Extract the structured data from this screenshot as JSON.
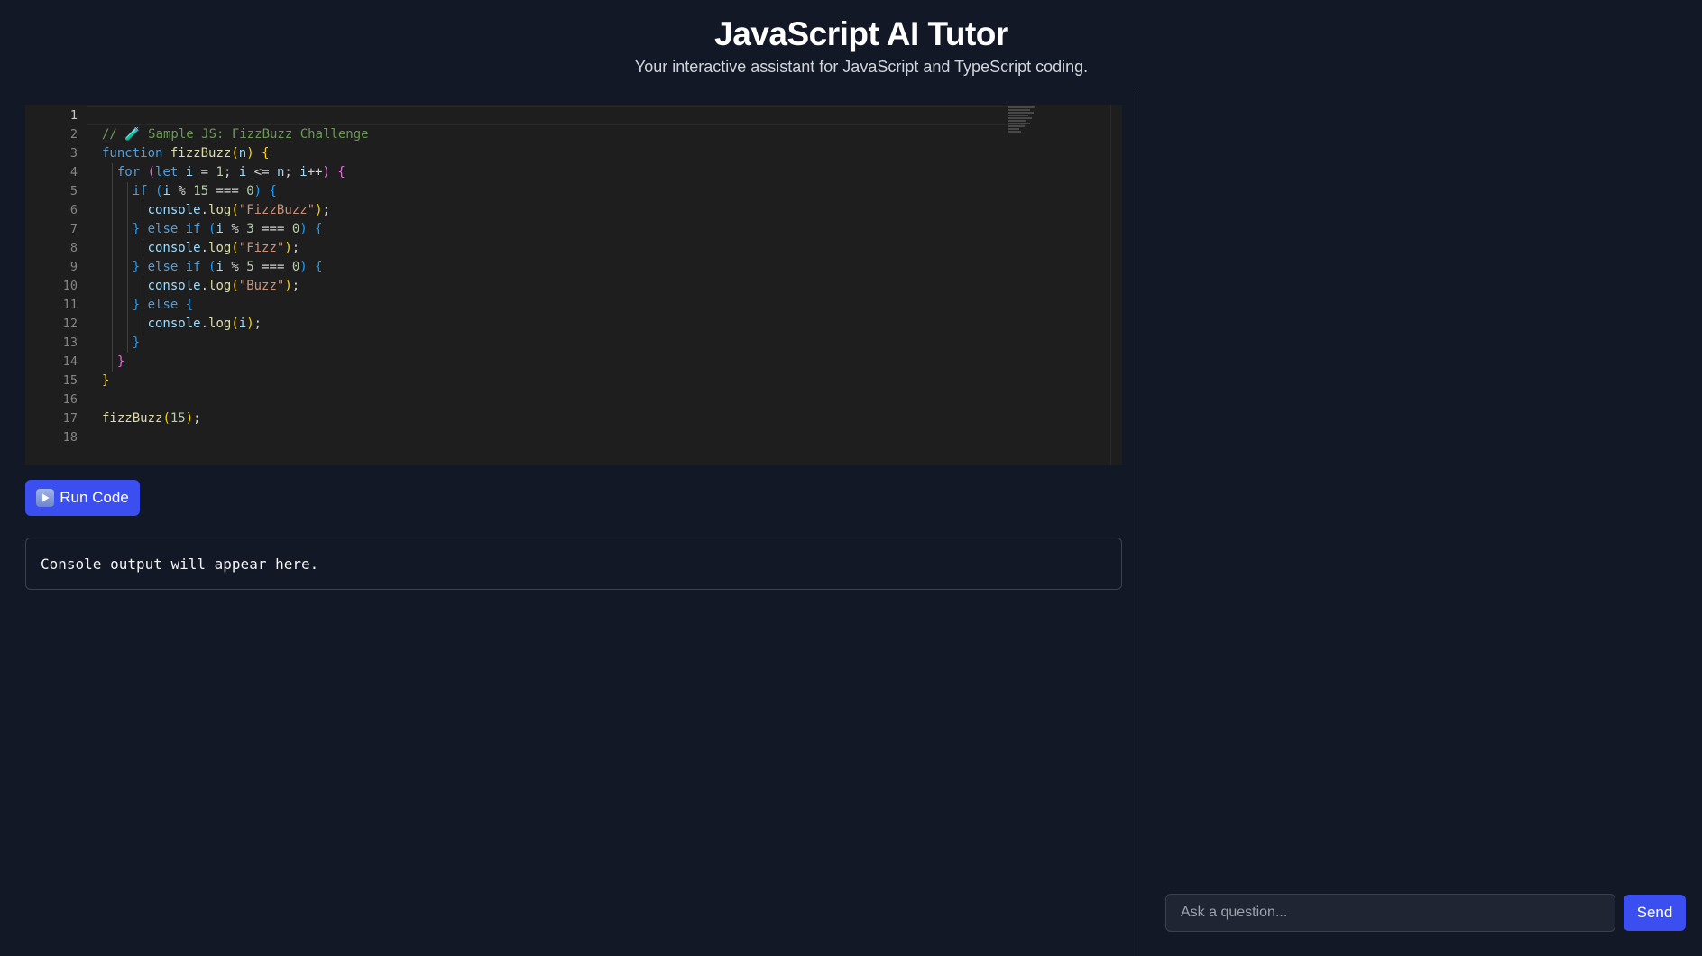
{
  "header": {
    "title": "JavaScript AI Tutor",
    "subtitle": "Your interactive assistant for JavaScript and TypeScript coding."
  },
  "editor": {
    "language": "javascript",
    "line_numbers": [
      "1",
      "2",
      "3",
      "4",
      "5",
      "6",
      "7",
      "8",
      "9",
      "10",
      "11",
      "12",
      "13",
      "14",
      "15",
      "16",
      "17",
      "18"
    ],
    "active_line": 1,
    "code": [
      "",
      "// 🧪 Sample JS: FizzBuzz Challenge",
      "function fizzBuzz(n) {",
      "  for (let i = 1; i <= n; i++) {",
      "    if (i % 15 === 0) {",
      "      console.log(\"FizzBuzz\");",
      "    } else if (i % 3 === 0) {",
      "      console.log(\"Fizz\");",
      "    } else if (i % 5 === 0) {",
      "      console.log(\"Buzz\");",
      "    } else {",
      "      console.log(i);",
      "    }",
      "  }",
      "}",
      "",
      "fizzBuzz(15);",
      ""
    ]
  },
  "run_button": {
    "label": "Run Code",
    "icon": "play-icon"
  },
  "console": {
    "text": "Console output will appear here."
  },
  "chat": {
    "input_placeholder": "Ask a question...",
    "input_value": "",
    "send_label": "Send"
  },
  "colors": {
    "background": "#121826",
    "accent": "#3b4ff0",
    "editor_bg": "#1e1e1e"
  }
}
